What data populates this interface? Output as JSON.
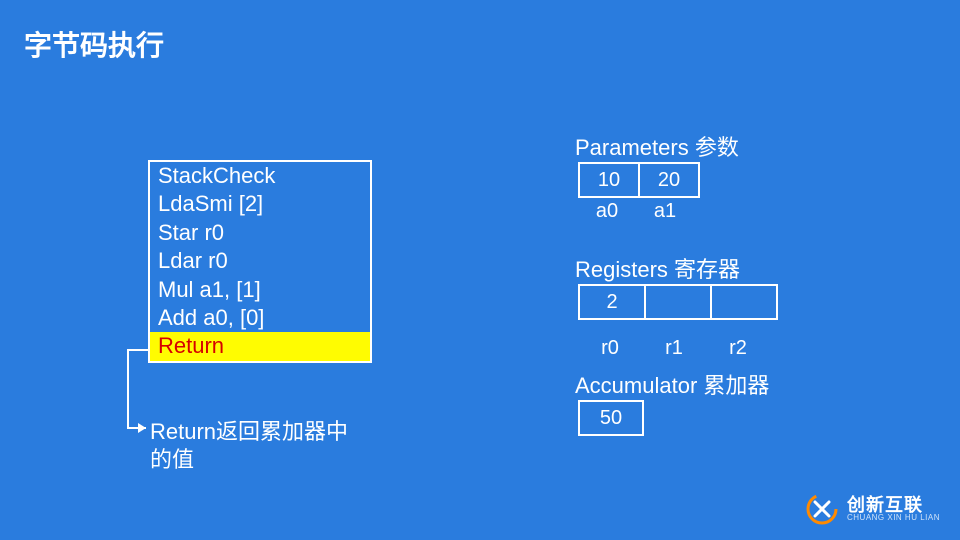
{
  "title": "字节码执行",
  "code": {
    "lines": [
      "StackCheck",
      "LdaSmi [2]",
      "Star r0",
      "Ldar r0",
      "Mul a1, [1]",
      "Add a0, [0]",
      "Return"
    ],
    "highlight_index": 6
  },
  "note": "Return返回累加器中的值",
  "parameters": {
    "title": "Parameters 参数",
    "cells": [
      "10",
      "20"
    ],
    "labels": [
      "a0",
      "a1"
    ]
  },
  "registers": {
    "title": "Registers 寄存器",
    "cells": [
      "2",
      "",
      ""
    ],
    "labels": [
      "r0",
      "r1",
      "r2"
    ]
  },
  "accumulator": {
    "title": "Accumulator 累加器",
    "cells": [
      "50"
    ]
  },
  "logo": {
    "cn": "创新互联",
    "en": "CHUANG XIN HU LIAN"
  },
  "colors": {
    "bg": "#2a7cde",
    "highlight_bg": "#fffc01",
    "highlight_fg": "#d60000",
    "logo_accent": "#ff8a00"
  }
}
